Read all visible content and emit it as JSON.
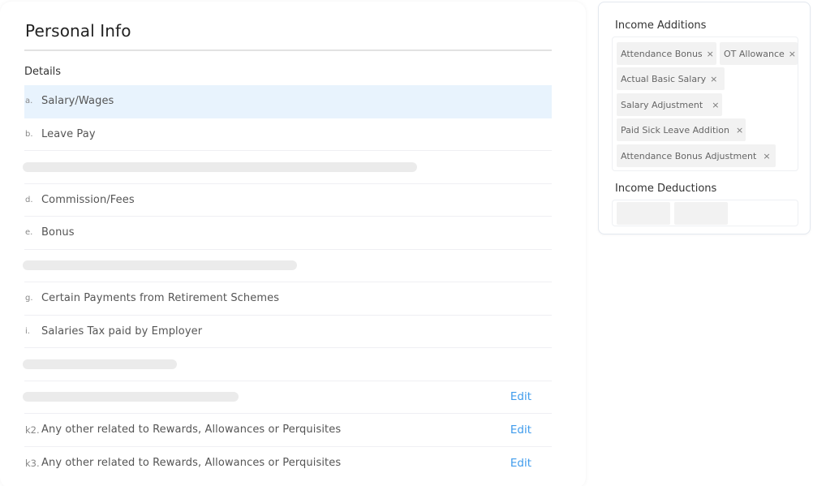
{
  "main": {
    "title": "Personal Info",
    "section_label": "Details",
    "rows": [
      {
        "index": "a.",
        "label": "Salary/Wages",
        "active": true
      },
      {
        "index": "b.",
        "label": "Leave Pay"
      },
      {
        "skeleton": true
      },
      {
        "index": "d.",
        "label": "Commission/Fees"
      },
      {
        "index": "e.",
        "label": "Bonus"
      },
      {
        "skeleton": true
      },
      {
        "index": "g.",
        "label": "Certain Payments from Retirement Schemes"
      },
      {
        "index": "i.",
        "label": "Salaries Tax paid by Employer"
      },
      {
        "skeleton": true
      },
      {
        "skeleton": true,
        "action": "Edit"
      },
      {
        "index": "k2.",
        "label": "Any other related to Rewards, Allowances or Perquisites",
        "action": "Edit"
      },
      {
        "index": "k3.",
        "label": "Any other related to Rewards, Allowances or Perquisites",
        "action": "Edit"
      }
    ]
  },
  "side": {
    "income_additions": {
      "heading": "Income Additions",
      "tags": [
        {
          "label": "Attendance Bonus",
          "remove_icon": "×"
        },
        {
          "label": "OT Allowance",
          "remove_icon": "×"
        },
        {
          "label": "Actual Basic Salary",
          "remove_icon": "×"
        },
        {
          "label": "Salary Adjustment",
          "remove_icon": "×"
        },
        {
          "label": "Paid Sick Leave Addition",
          "remove_icon": "×"
        },
        {
          "label": "Attendance Bonus Adjustment",
          "remove_icon": "×"
        }
      ]
    },
    "income_deductions": {
      "heading": "Income Deductions",
      "tags": []
    }
  },
  "colors": {
    "accent": "#3f9bec",
    "active_row": "#e8f3fd",
    "tag_bg": "#f2f2f2"
  }
}
